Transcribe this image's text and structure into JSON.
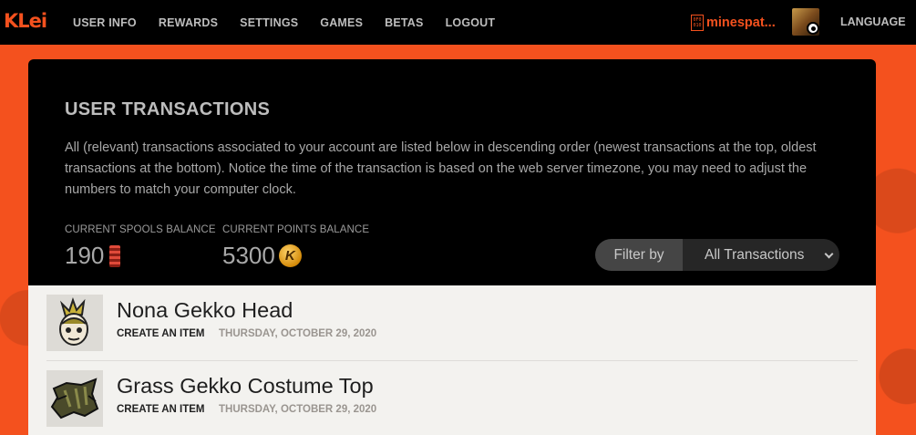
{
  "brand": {
    "logo_text": "KLei",
    "accent_color": "#f4511e"
  },
  "nav": {
    "items": [
      {
        "label": "USER INFO"
      },
      {
        "label": "REWARDS"
      },
      {
        "label": "SETTINGS"
      },
      {
        "label": "GAMES"
      },
      {
        "label": "BETAS"
      },
      {
        "label": "LOGOUT"
      }
    ],
    "username": "minespat...",
    "user_badge_icon": "klei-id-badge-icon",
    "avatar_icon": "user-avatar",
    "platform_icon": "steam-icon",
    "language_label": "LANGUAGE"
  },
  "page": {
    "title": "USER TRANSACTIONS",
    "description": "All (relevant) transactions associated to your account are listed below in descending order (newest transactions at the top, oldest transactions at the bottom). Notice the time of the transaction is based on the web server timezone, you may need to adjust the numbers to match your computer clock."
  },
  "balances": {
    "spools_label": "CURRENT SPOOLS BALANCE",
    "spools_value": "190",
    "spools_icon": "spool-icon",
    "points_label": "CURRENT POINTS BALANCE",
    "points_value": "5300",
    "points_icon": "klei-points-coin-icon"
  },
  "filter": {
    "label": "Filter by",
    "selected": "All Transactions"
  },
  "transactions": [
    {
      "name": "Nona Gekko Head",
      "action": "CREATE AN ITEM",
      "date": "THURSDAY, OCTOBER 29, 2020",
      "icon": "nona-gekko-head-icon"
    },
    {
      "name": "Grass Gekko Costume Top",
      "action": "CREATE AN ITEM",
      "date": "THURSDAY, OCTOBER 29, 2020",
      "icon": "grass-gekko-costume-top-icon"
    }
  ]
}
